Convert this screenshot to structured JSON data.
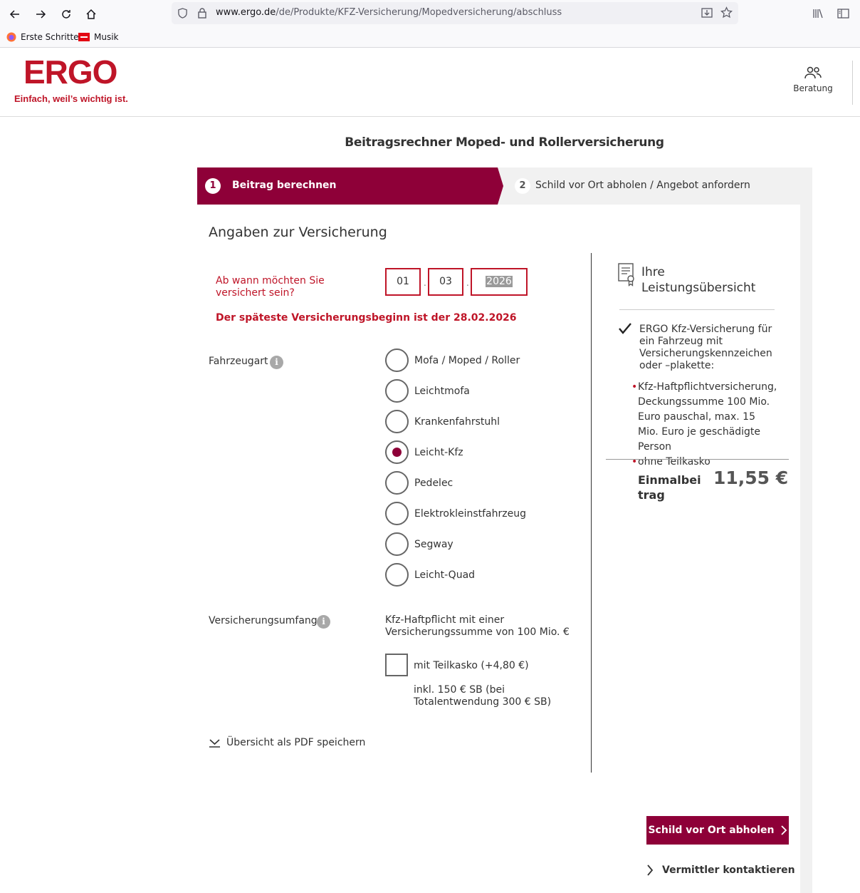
{
  "browser": {
    "url_domain": "www.ergo.de",
    "url_path": "/de/Produkte/KFZ-Versicherung/Mopedversicherung/abschluss",
    "bookmarks": [
      "Erste Schritte",
      "Musik"
    ]
  },
  "header": {
    "logo": "ERGO",
    "tagline": "Einfach, weil’s wichtig ist.",
    "beratung_label": "Beratung"
  },
  "page_title": "Beitragsrechner Moped- und Rollerversicherung",
  "steps": [
    {
      "num": "1",
      "label": "Beitrag berechnen"
    },
    {
      "num": "2",
      "label": "Schild vor Ort abholen / Angebot anfordern"
    }
  ],
  "section_title": "Angaben zur Versicherung",
  "date": {
    "label": "Ab wann möchten Sie versichert sein?",
    "day": "01",
    "month": "03",
    "year": "2026",
    "sep": ".",
    "error": "Der späteste Versicherungsbeginn ist der 28.02.2026"
  },
  "vehicle": {
    "label": "Fahrzeugart",
    "info": "i",
    "options": [
      "Mofa / Moped / Roller",
      "Leichtmofa",
      "Krankenfahrstuhl",
      "Leicht-Kfz",
      "Pedelec",
      "Elektrokleinstfahrzeug",
      "Segway",
      "Leicht-Quad"
    ],
    "selected": "Leicht-Kfz"
  },
  "coverage": {
    "label": "Versicherungsumfang:",
    "info": "i",
    "text": "Kfz-Haftpflicht mit einer Versicherungssumme von 100 Mio. €",
    "checkbox_label": "mit Teilkasko (+4,80 €)",
    "checkbox_note": "inkl. 150 € SB (bei Totalentwendung 300 € SB)",
    "checked": false
  },
  "pdf_link": "Übersicht als PDF speichern",
  "summary": {
    "title_line1": "Ihre",
    "title_line2": "Leistungsübersicht",
    "main": "ERGO Kfz-Versicherung für ein Fahrzeug mit Versicherungskennzeichen oder –plakette:",
    "bullets": [
      "Kfz-Haftpflichtversicherung, Deckungssumme 100 Mio. Euro pauschal, max. 15 Mio. Euro je geschädigte Person",
      "ohne Teilkasko"
    ],
    "price_label": "Einmalbeitrag",
    "price_value": "11,55 €"
  },
  "actions": {
    "primary": "Schild vor Ort abholen",
    "secondary": "Vermittler kontaktieren"
  },
  "colors": {
    "brand_red": "#bf1528",
    "primary_dark": "#8e0038"
  }
}
